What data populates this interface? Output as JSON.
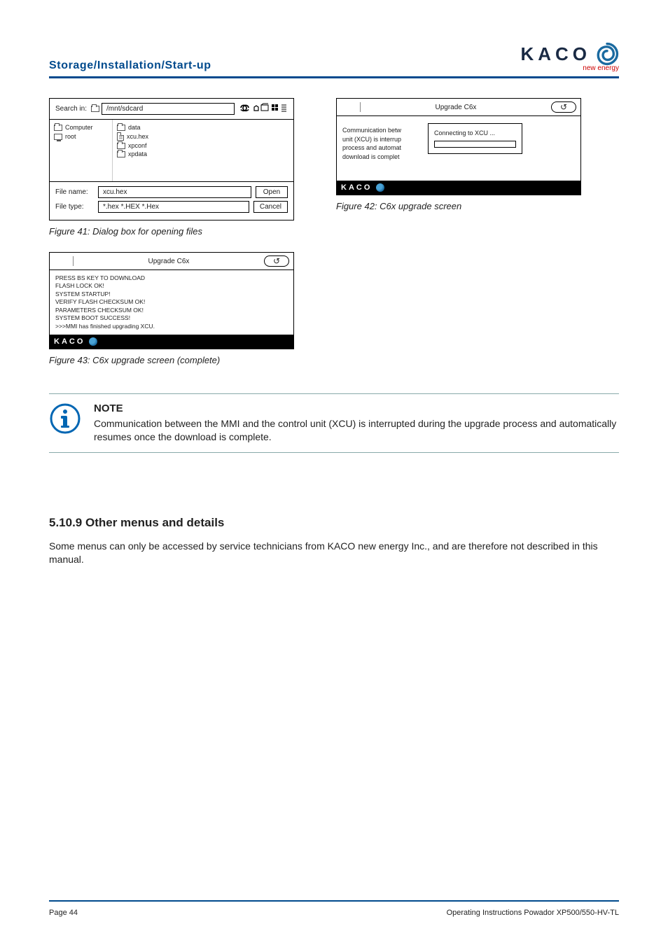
{
  "header": {
    "section": "Storage/Installation/Start-up"
  },
  "logo": {
    "brand": "KACO",
    "sub": "new energy"
  },
  "fig41": {
    "caption": "Figure 41:   Dialog box for opening files",
    "search_label": "Search in:",
    "search_value": "/mnt/sdcard",
    "tree": {
      "computer": "Computer",
      "root": "root"
    },
    "files": {
      "f0": "data",
      "f1": "xcu.hex",
      "f2": "xpconf",
      "f3": "xpdata"
    },
    "filename_label": "File name:",
    "filename_value": "xcu.hex",
    "filetype_label": "File type:",
    "filetype_value": "*.hex *.HEX *.Hex",
    "open": "Open",
    "cancel": "Cancel"
  },
  "fig42": {
    "caption": "Figure 42:   C6x upgrade screen",
    "title": "Upgrade C6x",
    "back": "↺",
    "behind_l1": "Communication betw",
    "behind_l2": "unit (XCU) is interrup",
    "behind_l3": "process and automat",
    "behind_l4": "download is complet",
    "popup": "Connecting to XCU ..."
  },
  "fig43": {
    "caption": "Figure 43:   C6x upgrade screen (complete)",
    "title": "Upgrade C6x",
    "back": "↺",
    "l1": "PRESS BS KEY TO DOWNLOAD",
    "l2": "FLASH LOCK OK!",
    "l3": "SYSTEM STARTUP!",
    "l4": "VERIFY FLASH CHECKSUM OK!",
    "l5": "PARAMETERS CHECKSUM OK!",
    "l6": "SYSTEM BOOT SUCCESS!",
    "l7": ">>>MMI has finished upgrading XCU."
  },
  "foot_brand": "KACO",
  "note": {
    "title": "NOTE",
    "body": "Communication between the MMI and the control unit (XCU) is interrupted during the upgrade process and automatically resumes once the download is complete."
  },
  "section": {
    "heading": "5.10.9  Other menus and details",
    "para": "Some menus can only be accessed by service technicians from KACO new energy Inc., and are therefore not described in this manual."
  },
  "footer": {
    "left": "Page 44",
    "right": "Operating Instructions Powador XP500/550-HV-TL"
  }
}
